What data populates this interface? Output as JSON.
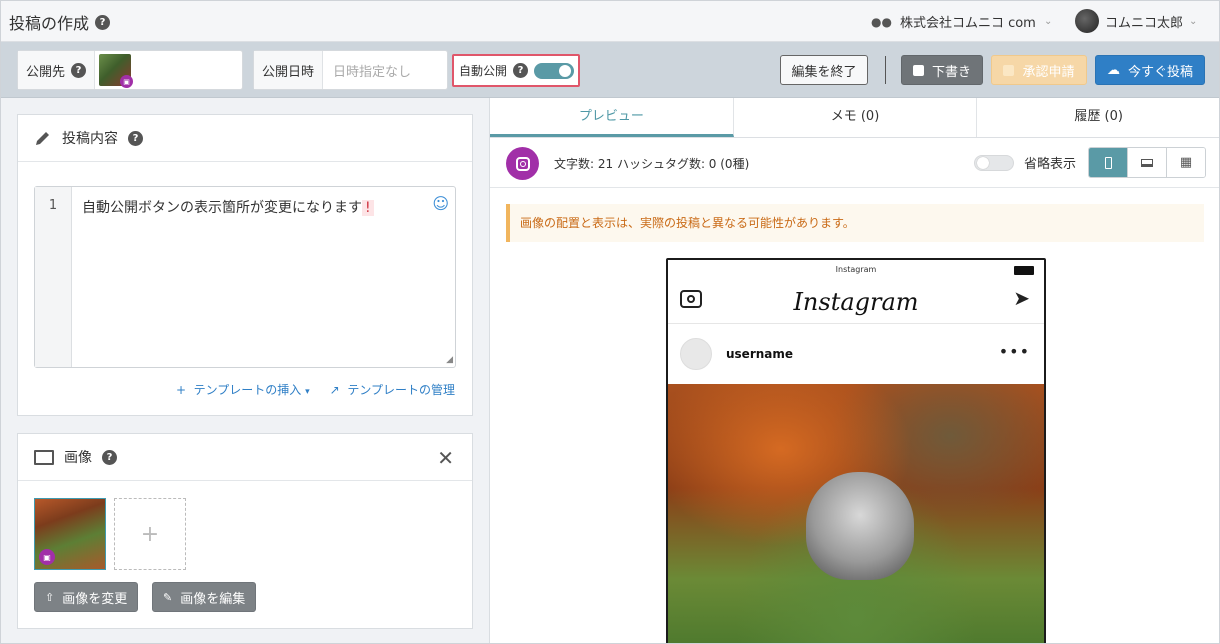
{
  "header": {
    "title": "投稿の作成",
    "company": "株式会社コムニコ comm",
    "user": "コムニコ太郎"
  },
  "toolbar": {
    "publish_to_label": "公開先",
    "publish_datetime_label": "公開日時",
    "publish_datetime_placeholder": "日時指定なし",
    "auto_publish_label": "自動公開",
    "auto_publish_on": true,
    "end_edit_label": "編集を終了",
    "draft_label": "下書き",
    "approval_label": "承認申請",
    "post_now_label": "今すぐ投稿"
  },
  "content_card": {
    "title": "投稿内容",
    "line_number": "1",
    "text": "自動公開ボタンの表示箇所が変更になります",
    "text_mark": "!",
    "template_insert": "テンプレートの挿入",
    "template_manage": "テンプレートの管理"
  },
  "image_card": {
    "title": "画像",
    "change_label": "画像を変更",
    "edit_label": "画像を編集",
    "add_symbol": "+"
  },
  "preview": {
    "tabs": [
      {
        "label": "プレビュー",
        "active": true
      },
      {
        "label": "メモ (0)",
        "active": false
      },
      {
        "label": "履歴 (0)",
        "active": false
      }
    ],
    "counts": "文字数: 21 ハッシュタグ数: 0 (0種)",
    "abbreviate_label": "省略表示",
    "notice": "画像の配置と表示は、実際の投稿と異なる可能性があります。",
    "phone": {
      "status_title": "Instagram",
      "logo": "Instagram",
      "username": "username"
    }
  },
  "colors": {
    "accent": "#5a9aa6",
    "post_button": "#2f7fc6",
    "instagram": "#a12fa8",
    "highlight_border": "#e0566a"
  }
}
